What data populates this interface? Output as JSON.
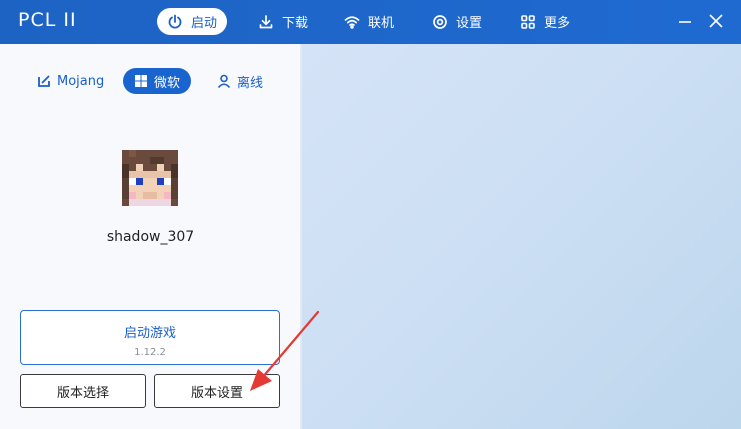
{
  "app": {
    "title": "PCL II"
  },
  "nav": {
    "items": [
      {
        "label": "启动",
        "icon": "rocket-icon",
        "active": true
      },
      {
        "label": "下载",
        "icon": "download-icon",
        "active": false
      },
      {
        "label": "联机",
        "icon": "wifi-icon",
        "active": false
      },
      {
        "label": "设置",
        "icon": "gear-icon",
        "active": false
      },
      {
        "label": "更多",
        "icon": "grid-icon",
        "active": false
      }
    ]
  },
  "account": {
    "tabs": [
      {
        "label": "Mojang",
        "icon": "mojang-icon",
        "active": false
      },
      {
        "label": "微软",
        "icon": "windows-icon",
        "active": true
      },
      {
        "label": "离线",
        "icon": "person-icon",
        "active": false
      }
    ],
    "username": "shadow_307"
  },
  "launch": {
    "title": "启动游戏",
    "version": "1.12.2"
  },
  "buttons": {
    "version_select": "版本选择",
    "version_settings": "版本设置"
  },
  "colors": {
    "accent": "#1a64cf",
    "annotation_arrow": "#e53935"
  }
}
